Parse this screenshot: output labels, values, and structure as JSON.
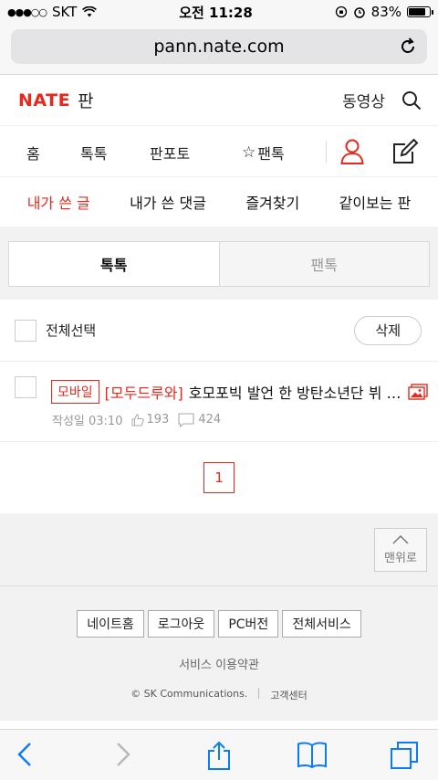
{
  "status_bar": {
    "carrier": "SKT",
    "time": "오전 11:28",
    "battery": "83%",
    "battery_level": 0.83
  },
  "browser": {
    "url": "pann.nate.com"
  },
  "header": {
    "brand": "NATE",
    "section": "판",
    "video_label": "동영상"
  },
  "nav": {
    "items": [
      "홈",
      "톡톡",
      "판포토",
      "팬톡"
    ]
  },
  "subnav": {
    "items": [
      "내가 쓴 글",
      "내가 쓴 댓글",
      "즐겨찾기",
      "같이보는 판"
    ],
    "active_index": 0
  },
  "tabs": {
    "items": [
      "톡톡",
      "팬톡"
    ],
    "active_index": 0
  },
  "list": {
    "select_all_label": "전체선택",
    "delete_label": "삭제",
    "posts": [
      {
        "badge": "모바일",
        "category": "[모두드루와]",
        "title": "호모포빅 발언 한 방탄소년단 뷔 팬들",
        "date": "작성일 03:10",
        "likes": "193",
        "comments": "424"
      }
    ]
  },
  "pager": {
    "current": "1"
  },
  "top_button": {
    "label": "맨위로"
  },
  "footer": {
    "buttons": [
      "네이트홈",
      "로그아웃",
      "PC버전",
      "전체서비스"
    ],
    "terms": "서비스 이용약관",
    "copyright": "© SK Communications.",
    "help": "고객센터"
  },
  "colors": {
    "accent": "#e8281d",
    "ios_blue": "#0a7aff"
  }
}
